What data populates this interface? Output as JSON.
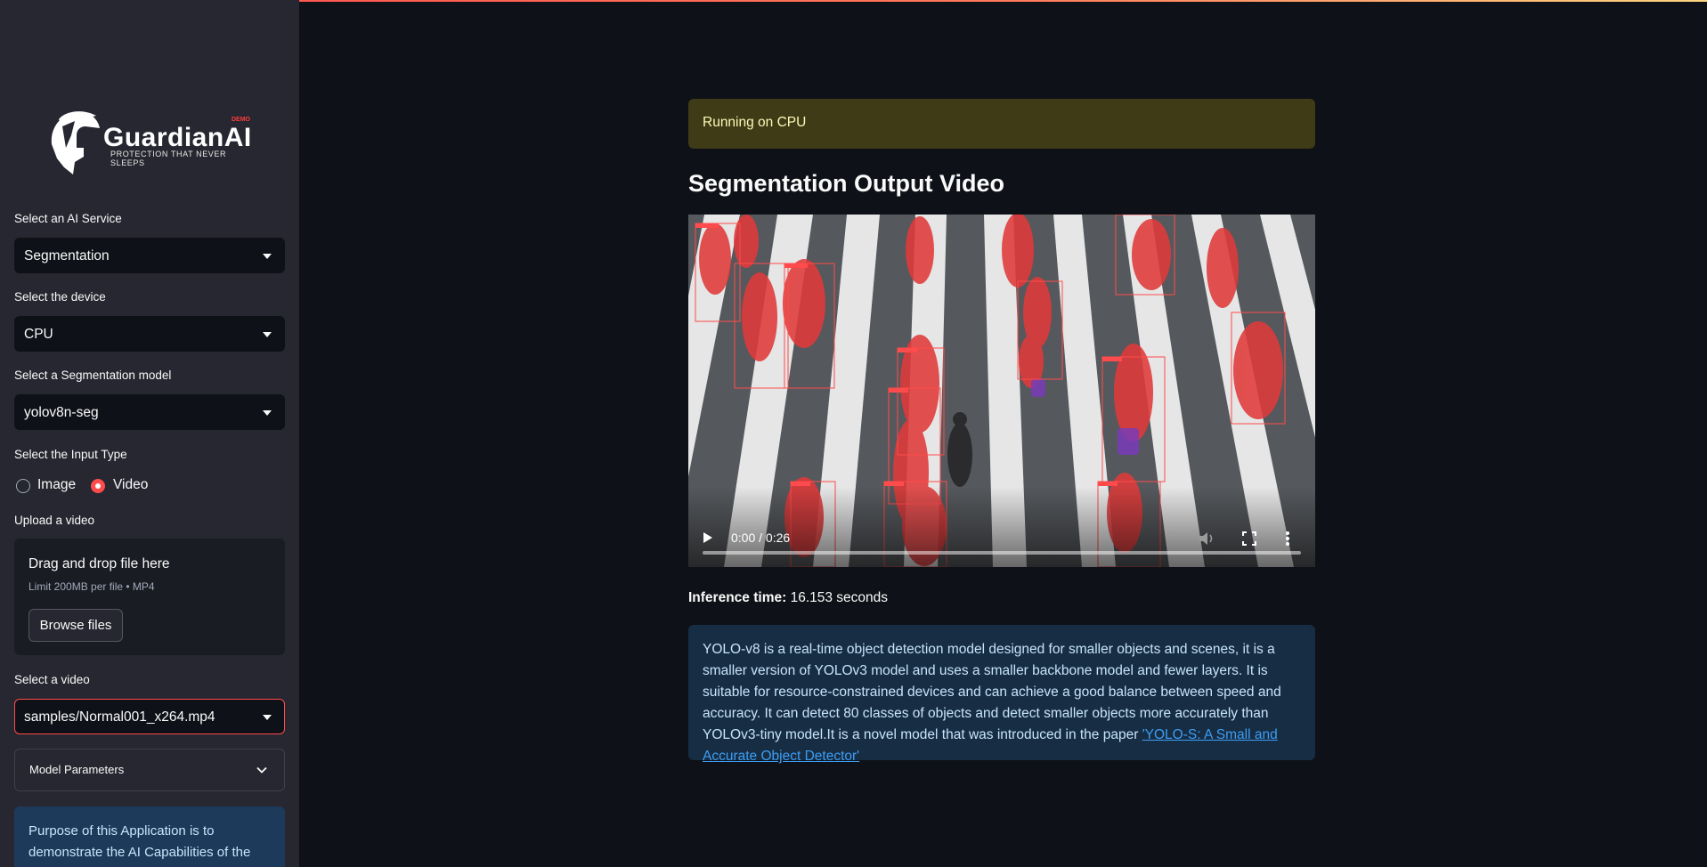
{
  "app": {
    "brand": "GuardianAI",
    "tagline": "PROTECTION THAT NEVER SLEEPS",
    "badge": "DEMO"
  },
  "sidebar": {
    "service_label": "Select an AI Service",
    "service_value": "Segmentation",
    "device_label": "Select the device",
    "device_value": "CPU",
    "model_label": "Select a Segmentation model",
    "model_value": "yolov8n-seg",
    "input_type_label": "Select the Input Type",
    "input_options": [
      {
        "label": "Image",
        "selected": false
      },
      {
        "label": "Video",
        "selected": true
      }
    ],
    "upload_label": "Upload a video",
    "upload": {
      "drag_text": "Drag and drop file here",
      "limit_text": "Limit 200MB per file • MP4",
      "browse_label": "Browse files"
    },
    "video_select_label": "Select a video",
    "video_select_value": "samples/Normal001_x264.mp4",
    "expander_label": "Model Parameters",
    "info_text": "Purpose of this Application is to demonstrate the AI Capabilities of the"
  },
  "main": {
    "status_text": "Running on CPU",
    "heading": "Segmentation Output Video",
    "video": {
      "time": "0:00 / 0:26",
      "progress": 0
    },
    "inference_label": "Inference time:",
    "inference_value": "16.153 seconds",
    "description": "YOLO-v8 is a real-time object detection model designed for smaller objects and scenes, it is a smaller version of YOLOv3 model and uses a smaller backbone model and fewer layers. It is suitable for resource-constrained devices and can achieve a good balance between speed and accuracy. It can detect 80 classes of objects and detect smaller objects more accurately than YOLOv3-tiny model.It is a novel model that was introduced in the paper ",
    "paper_link": "'YOLO-S: A Small and Accurate Object Detector'"
  },
  "colors": {
    "accent": "#ff4b4b",
    "sidebar_bg": "#262730",
    "main_bg": "#0e1117",
    "warning_bg": "#3e3b16",
    "info_bg": "#172d43"
  }
}
